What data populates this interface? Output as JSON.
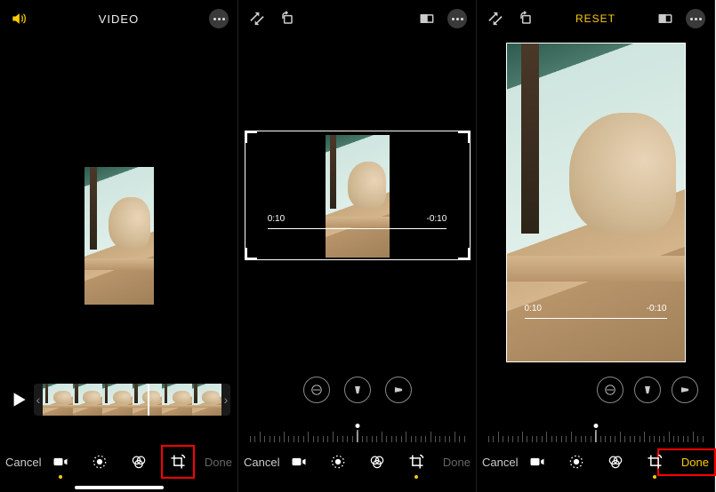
{
  "panel1": {
    "top_title": "VIDEO",
    "cancel": "Cancel",
    "done": "Done"
  },
  "panel2": {
    "time_start": "0:10",
    "time_end": "-0:10",
    "cancel": "Cancel",
    "done": "Done"
  },
  "panel3": {
    "top_title": "RESET",
    "time_start": "0:10",
    "time_end": "-0:10",
    "cancel": "Cancel",
    "done": "Done"
  },
  "icons": {
    "volume": "volume-icon",
    "more": "more-icon",
    "perspective": "perspective-icon",
    "rotate": "rotate-icon",
    "aspect": "aspect-icon",
    "straighten": "straighten-icon",
    "flip_h": "flip-horizontal-icon",
    "flip_v": "flip-vertical-icon",
    "video": "video-icon",
    "adjust": "adjust-icon",
    "filters": "filters-icon",
    "crop": "crop-icon",
    "play": "play-icon"
  }
}
